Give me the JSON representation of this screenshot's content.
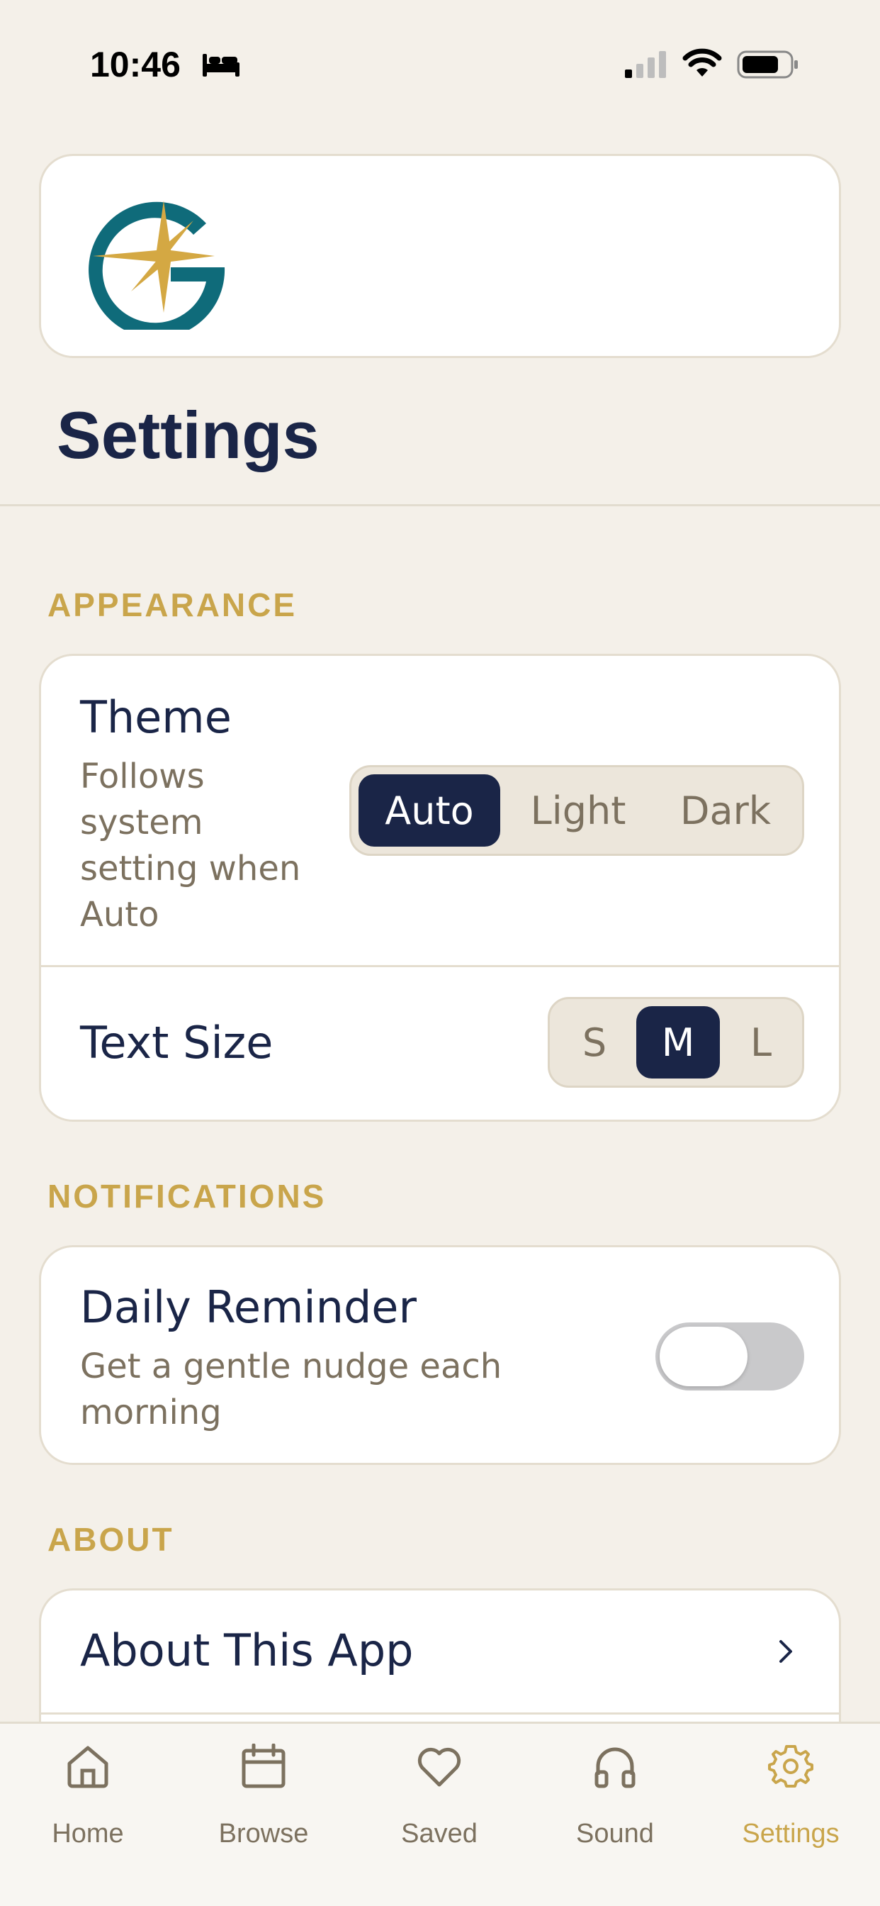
{
  "status_bar": {
    "time": "10:46",
    "icons": [
      "bed-icon",
      "cellular-signal-icon",
      "wifi-icon",
      "battery-icon"
    ]
  },
  "logo": {
    "icon": "compass-star-logo",
    "colors": {
      "primary": "#0f6b7a",
      "accent": "#d4a843"
    }
  },
  "page_title": "Settings",
  "sections": {
    "appearance": {
      "header": "APPEARANCE",
      "theme": {
        "title": "Theme",
        "subtitle_lines": [
          "Follows",
          "system",
          "setting when",
          "Auto"
        ],
        "options": [
          "Auto",
          "Light",
          "Dark"
        ],
        "selected": "Auto"
      },
      "text_size": {
        "title": "Text Size",
        "options": [
          "S",
          "M",
          "L"
        ],
        "selected": "M"
      }
    },
    "notifications": {
      "header": "NOTIFICATIONS",
      "daily_reminder": {
        "title": "Daily Reminder",
        "subtitle_lines": [
          "Get a gentle nudge each",
          "morning"
        ],
        "enabled": false
      }
    },
    "about": {
      "header": "ABOUT",
      "about_app": {
        "title": "About This App",
        "icon": "chevron-right-icon"
      }
    }
  },
  "tab_bar": {
    "tabs": [
      {
        "label": "Home",
        "icon": "home-icon"
      },
      {
        "label": "Browse",
        "icon": "calendar-icon"
      },
      {
        "label": "Saved",
        "icon": "heart-icon"
      },
      {
        "label": "Sound",
        "icon": "headphones-icon"
      },
      {
        "label": "Settings",
        "icon": "gear-icon"
      }
    ],
    "active": "Settings"
  },
  "colors": {
    "background": "#f4f0e9",
    "navy": "#1a2547",
    "gold": "#c9a54b",
    "muted_text": "#7c715f"
  }
}
